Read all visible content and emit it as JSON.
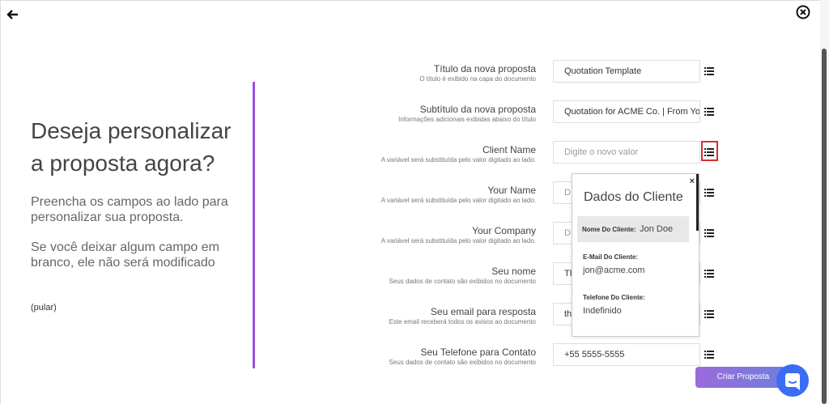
{
  "left": {
    "title_line1": "Deseja personalizar",
    "title_line2": "a proposta agora?",
    "subtitle_line1": "Preencha os campos ao lado para",
    "subtitle_line2": "personalizar sua proposta.",
    "note_line1": "Se você deixar algum campo em",
    "note_line2": "branco, ele não será modificado",
    "skip_label": "(pular)"
  },
  "form": {
    "rows": [
      {
        "label": "Título da nova proposta",
        "help": "O título é exibido na capa do documento",
        "value": "Quotation Template",
        "placeholder": ""
      },
      {
        "label": "Subtítulo da nova proposta",
        "help": "Informações adicionais exibidas abaixo do título",
        "value": "Quotation for ACME Co. | From You",
        "placeholder": ""
      },
      {
        "label": "Client Name",
        "help": "A variável será substituída pelo valor digitado ao lado.",
        "value": "",
        "placeholder": "Digite o novo valor"
      },
      {
        "label": "Your Name",
        "help": "A variável será substituída pelo valor digitado ao lado.",
        "value": "",
        "placeholder": "D"
      },
      {
        "label": "Your Company",
        "help": "A variável será substituída pelo valor digitado ao lado.",
        "value": "",
        "placeholder": "D"
      },
      {
        "label": "Seu nome",
        "help": "Seus dados de contato são exibidos no documento",
        "value": "Th",
        "placeholder": ""
      },
      {
        "label": "Seu email para resposta",
        "help": "Este email receberá todos os avisos ao documento",
        "value": "th",
        "placeholder": ""
      },
      {
        "label": "Seu Telefone para Contato",
        "help": "Seus dados de contato são exibidos no documento",
        "value": "+55 5555-5555",
        "placeholder": ""
      }
    ]
  },
  "popup": {
    "title": "Dados do Cliente",
    "close_symbol": "×",
    "fields": [
      {
        "label": "Nome Do Cliente:",
        "value": "Jon Doe"
      },
      {
        "label": "E-Mail Do Cliente:",
        "value": "jon@acme.com"
      },
      {
        "label": "Telefone Do Cliente:",
        "value": "Indefinido"
      }
    ]
  },
  "actions": {
    "create_label": "Criar Proposta"
  },
  "icons": {
    "back": "arrow-left-icon",
    "close": "close-circle-icon",
    "list": "list-icon",
    "chat": "chat-icon"
  },
  "colors": {
    "accent": "#9b51e0",
    "highlight": "#d32f2f",
    "chat": "#3b6cf5"
  }
}
